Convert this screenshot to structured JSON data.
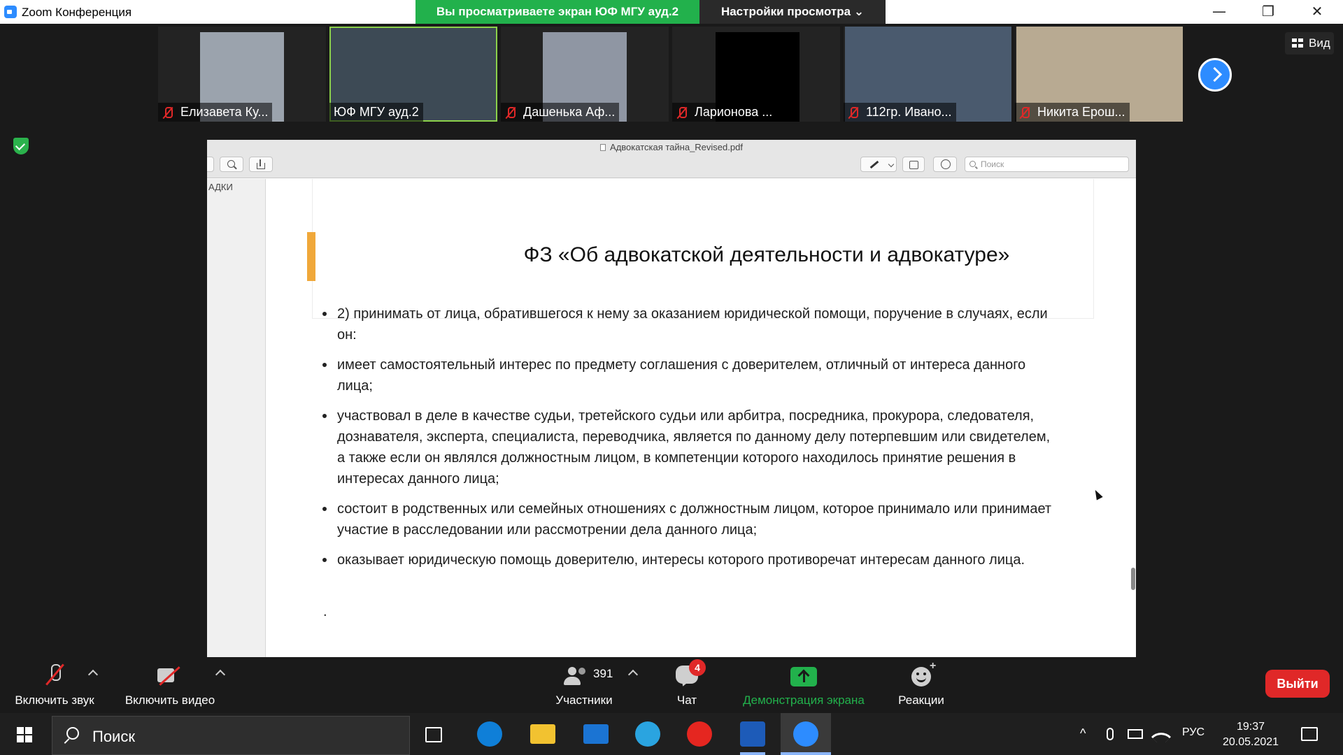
{
  "window": {
    "title": "Zoom Конференция",
    "minimize_glyph": "—",
    "restore_glyph": "❐",
    "close_glyph": "✕"
  },
  "share_banner": {
    "text": "Вы просматриваете экран ЮФ МГУ ауд.2",
    "view_settings": "Настройки просмотра ⌄"
  },
  "participants_strip": [
    {
      "name": "Елизавета Ку...",
      "muted": true,
      "video_color": "#9ba3ad"
    },
    {
      "name": "ЮФ МГУ ауд.2",
      "muted": false,
      "active": true,
      "video_color": "#3d4a55"
    },
    {
      "name": "Дашенька Аф...",
      "muted": true,
      "video_color": "#8f96a3"
    },
    {
      "name": "Ларионова ...",
      "muted": true,
      "video_color": "#000000"
    },
    {
      "name": "112гр. Ивано...",
      "muted": true,
      "video_color": "#4a5a6e"
    },
    {
      "name": "Никита Ерош...",
      "muted": true,
      "video_color": "#b8aa92"
    }
  ],
  "view_button": "Вид",
  "pdf": {
    "filename": "Адвокатская тайна_Revised.pdf",
    "search_placeholder": "Поиск",
    "sidebar_label": "АДКИ",
    "slide_title": "ФЗ «Об адвокатской деятельности и адвокатуре»",
    "bullets": [
      "2) принимать от лица, обратившегося к нему за оказанием юридической помощи, поручение в случаях, если он:",
      "имеет самостоятельный интерес по предмету соглашения с доверителем, отличный от интереса данного лица;",
      "участвовал в деле в качестве судьи, третейского судьи или арбитра, посредника, прокурора, следователя, дознавателя, эксперта, специалиста, переводчика, является по данному делу потерпевшим или свидетелем, а также если он являлся должностным лицом, в компетенции которого находилось принятие решения в интересах данного лица;",
      "состоит в родственных или семейных отношениях с должностным лицом, которое принимало или принимает участие в расследовании или рассмотрении дела данного лица;",
      "оказывает юридическую помощь доверителю, интересы которого противоречат интересам данного лица."
    ],
    "trailing_dot": ".",
    "accent_color": "#f0a83a"
  },
  "controls": {
    "mic_label": "Включить звук",
    "video_label": "Включить видео",
    "participants_count": "391",
    "participants_label": "Участники",
    "chat_label": "Чат",
    "chat_badge": "4",
    "share_label": "Демонстрация экрана",
    "reactions_label": "Реакции",
    "leave_label": "Выйти",
    "share_color": "#22b14c",
    "leave_color": "#e02828"
  },
  "taskbar": {
    "search_text": "Поиск",
    "apps": [
      {
        "name": "task-view",
        "color": "#1f1f1f"
      },
      {
        "name": "edge",
        "color": "#0f7fd8"
      },
      {
        "name": "explorer",
        "color": "#f2c230"
      },
      {
        "name": "mail",
        "color": "#1b74d3"
      },
      {
        "name": "telegram",
        "color": "#2aa4e0"
      },
      {
        "name": "yandex",
        "color": "#e52620"
      },
      {
        "name": "word",
        "color": "#1d5bb8"
      },
      {
        "name": "zoom",
        "color": "#2d8cff"
      }
    ],
    "tray_chevron": "^",
    "language": "РУС",
    "time": "19:37",
    "date": "20.05.2021"
  }
}
